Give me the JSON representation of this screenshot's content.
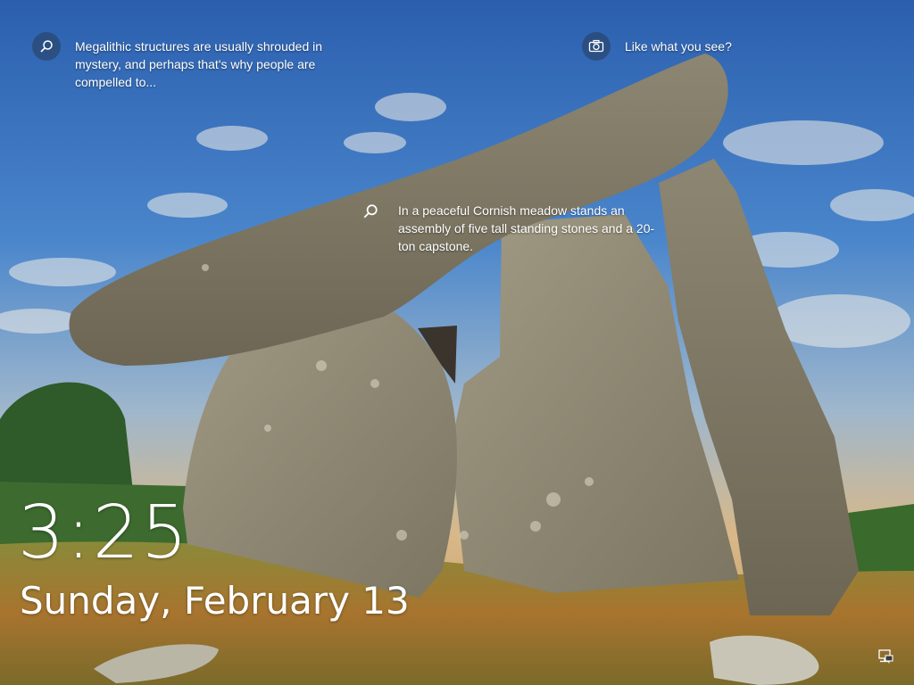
{
  "spotlight": {
    "top_left_hint": "Megalithic structures are usually shrouded in mystery, and perhaps that's why people are compelled to...",
    "top_right_hint": "Like what you see?",
    "center_hint": "In a peaceful Cornish meadow stands an assembly of five tall standing stones and a 20-ton capstone."
  },
  "lockscreen": {
    "time": "3:25",
    "date": "Sunday, February 13"
  },
  "icons": {
    "search": "search-icon",
    "camera": "camera-icon",
    "network": "network-icon"
  }
}
